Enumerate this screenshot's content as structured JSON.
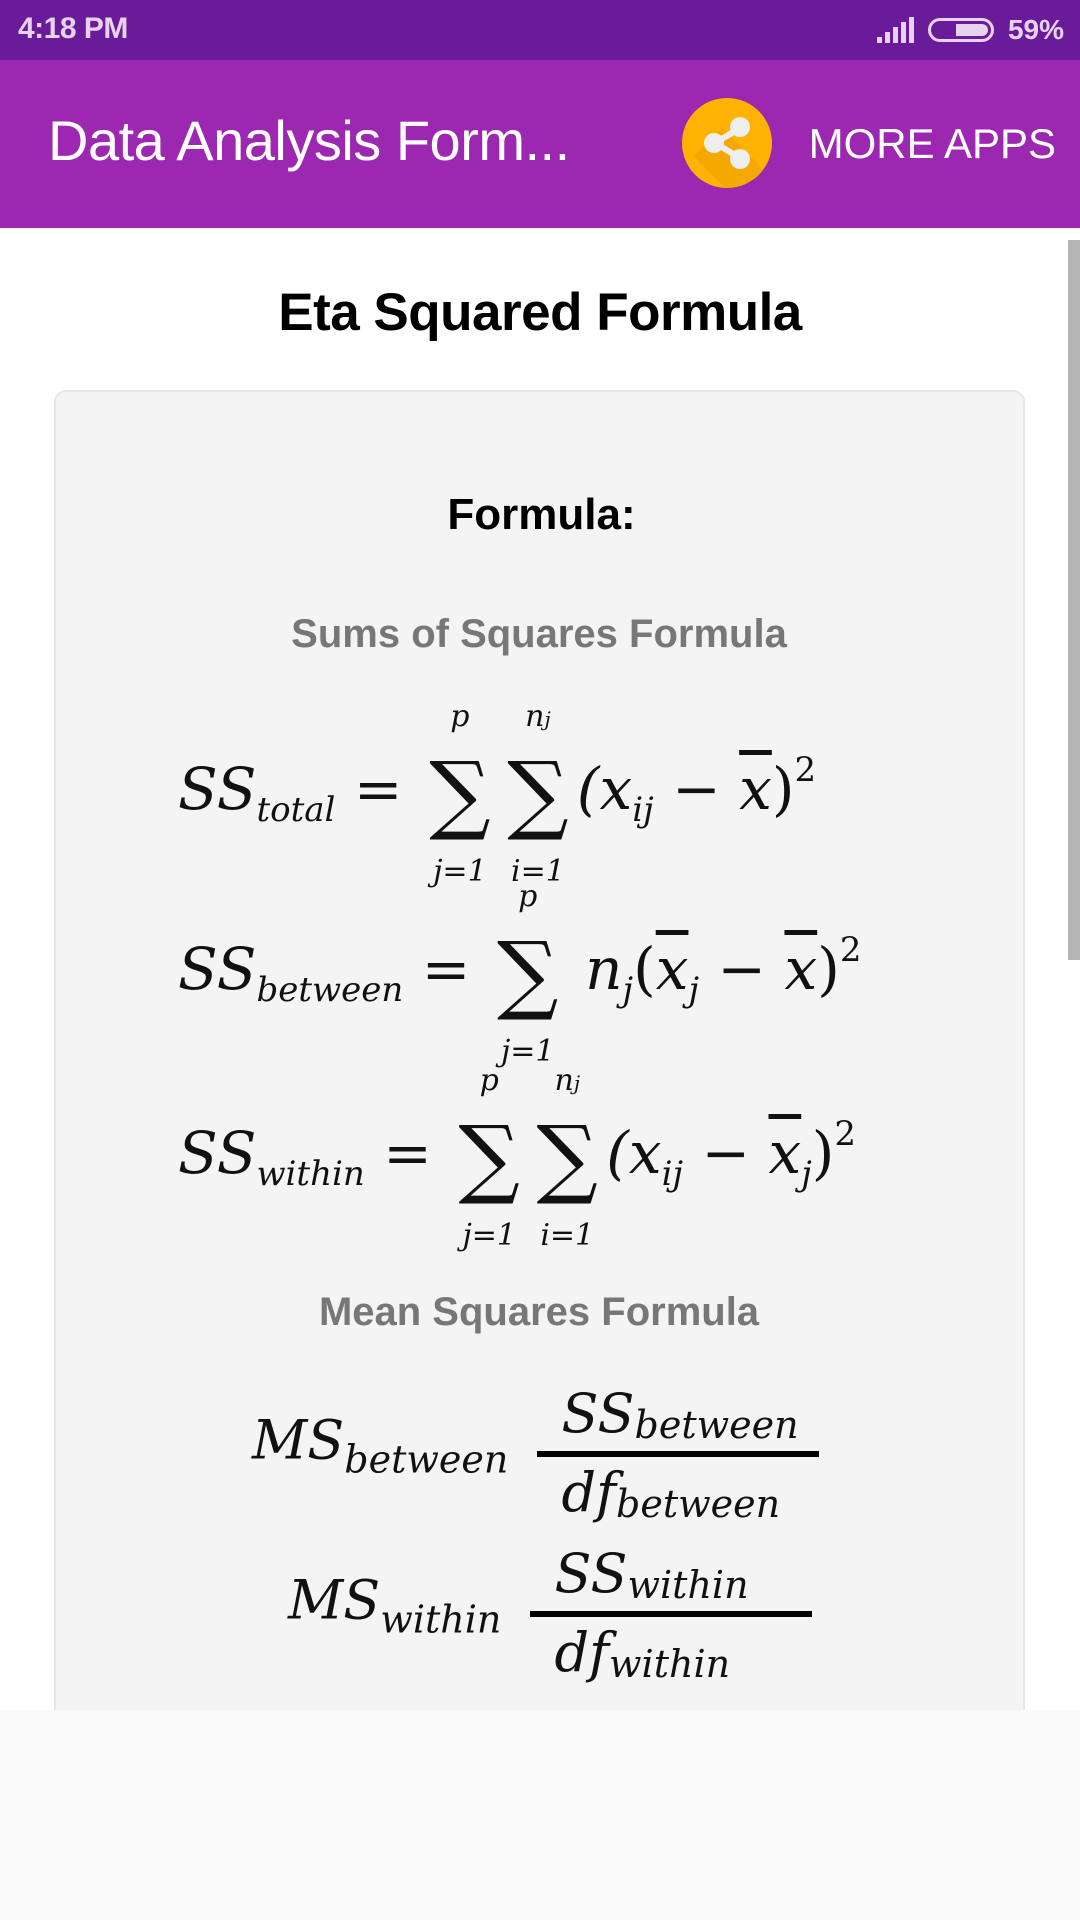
{
  "status_bar": {
    "time": "4:18 PM",
    "battery_percent": "59%",
    "battery_level": 0.59,
    "signal_icon": "signal-bars-icon",
    "battery_icon": "battery-icon"
  },
  "app_bar": {
    "title": "Data Analysis Form...",
    "share_icon": "share-icon",
    "more_apps_label": "MORE APPS",
    "colors": {
      "status_bar": "#6a1b9a",
      "app_bar": "#9c27b0",
      "share_button": "#ffb300"
    }
  },
  "page": {
    "title": "Eta Squared Formula",
    "card": {
      "heading": "Formula:",
      "sections": [
        {
          "title": "Sums of Squares Formula",
          "formulas": [
            {
              "lhs": "SS",
              "lhs_sub": "total",
              "sum1_top": "p",
              "sum1_bot": "j=1",
              "sum2_top": "n",
              "sum2_top_sub": "j",
              "sum2_bot": "i=1",
              "body": "(x",
              "body_sub": "ij",
              "minus": " − ",
              "xbar": "x",
              "close": ")",
              "power": "2"
            },
            {
              "lhs": "SS",
              "lhs_sub": "between",
              "sum1_top": "p",
              "sum1_bot": "j=1",
              "coef": "n",
              "coef_sub": "j",
              "open": "(",
              "xbar1": "x",
              "xbar1_sub": "j",
              "minus": " − ",
              "xbar2": "x",
              "close": ")",
              "power": "2"
            },
            {
              "lhs": "SS",
              "lhs_sub": "within",
              "sum1_top": "p",
              "sum1_bot": "j=1",
              "sum2_top": "n",
              "sum2_top_sub": "j",
              "sum2_bot": "i=1",
              "body": "(x",
              "body_sub": "ij",
              "minus": " − ",
              "xbar": "x",
              "xbar_sub": "j",
              "close": ")",
              "power": "2"
            }
          ]
        },
        {
          "title": "Mean Squares Formula",
          "formulas": [
            {
              "lhs": "MS",
              "lhs_sub": "between",
              "num": "SS",
              "num_sub": "between",
              "den": "df",
              "den_sub": "between"
            },
            {
              "lhs": "MS",
              "lhs_sub": "within",
              "num": "SS",
              "num_sub": "within",
              "den": "df",
              "den_sub": "within"
            }
          ]
        }
      ]
    }
  },
  "equals": "=",
  "sigma": "∑"
}
